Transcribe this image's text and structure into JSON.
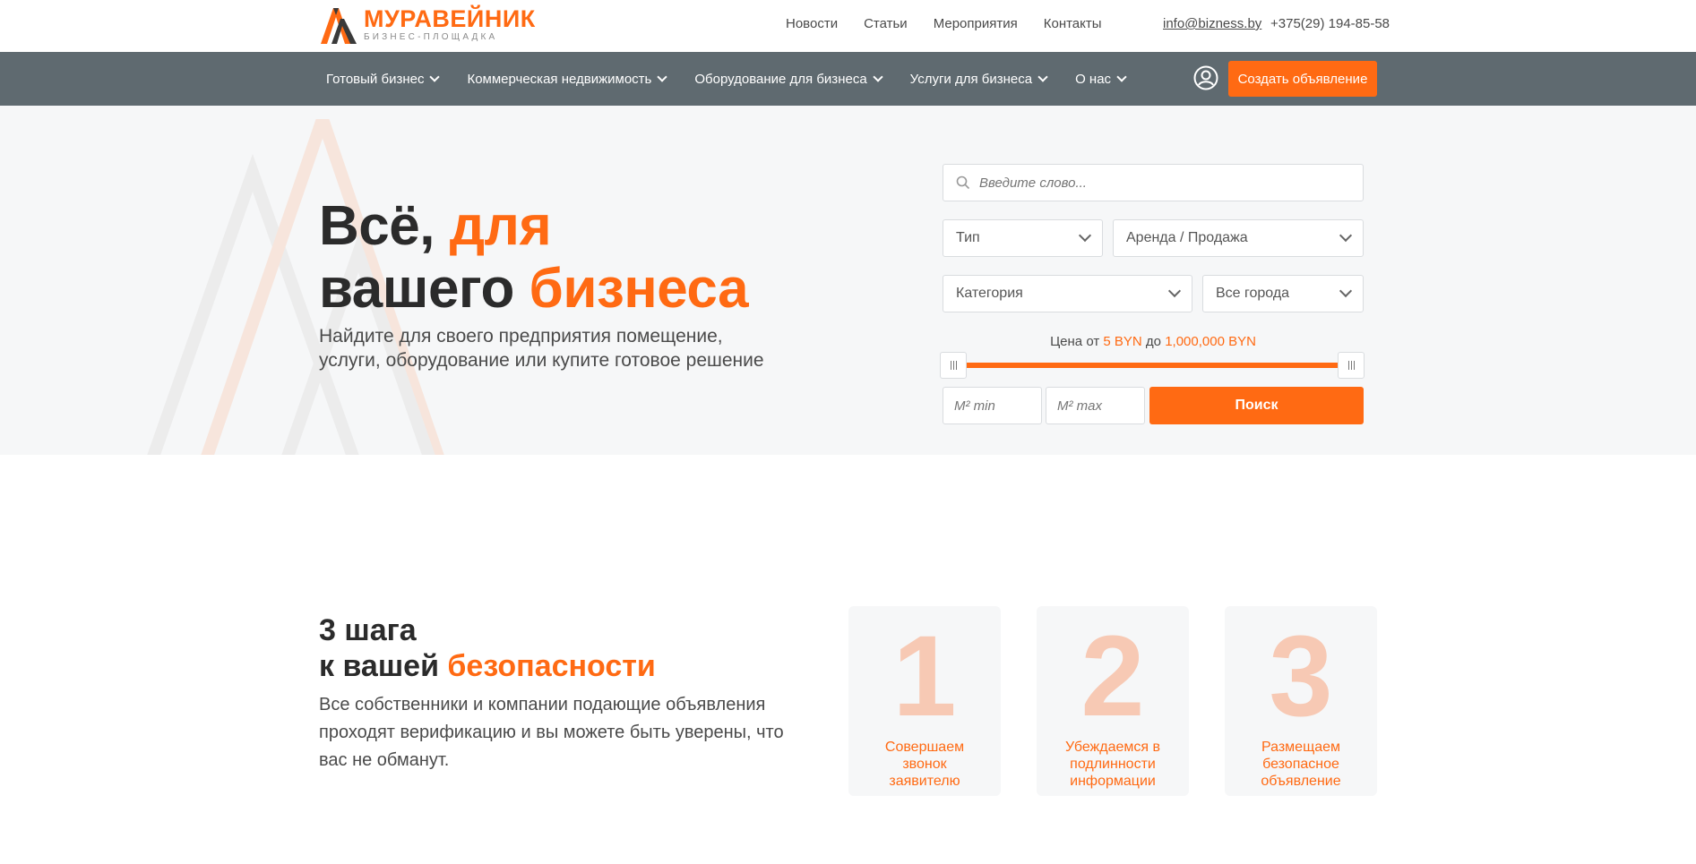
{
  "brand": {
    "name": "МУРАВЕЙНИК",
    "tagline": "БИЗНЕС-ПЛОЩАДКА",
    "accent_color": "#ff6a13",
    "nav_bg_color": "#5f6a70"
  },
  "top_nav": {
    "items": [
      "Новости",
      "Статьи",
      "Мероприятия",
      "Контакты"
    ],
    "email": "info@bizness.by",
    "phone": "+375(29) 194-85-58"
  },
  "main_nav": {
    "items": [
      {
        "label": "Готовый бизнес"
      },
      {
        "label": "Коммерческая недвижимость"
      },
      {
        "label": "Оборудование для бизнеса"
      },
      {
        "label": "Услуги для бизнеса"
      },
      {
        "label": "О нас"
      }
    ],
    "user_icon": "user-circle-icon",
    "create_button": "Создать объявление"
  },
  "hero": {
    "title_part1": "Всё, ",
    "title_part2": "для",
    "title_part3": "вашего ",
    "title_part4": "бизнеса",
    "subtitle": "Найдите для своего предприятия помещение, услуги, оборудование или купите готовое решение"
  },
  "search": {
    "placeholder": "Введите слово...",
    "type_select": "Тип",
    "deal_select": "Аренда / Продажа",
    "category_select": "Категория",
    "city_select": "Все города",
    "price_prefix": "Цена",
    "price_from_word": "от",
    "price_min": "5 BYN",
    "price_to_word": "до",
    "price_max": "1,000,000 BYN",
    "slider_min_fraction": 0.0,
    "slider_max_fraction": 1.0,
    "m2_min_placeholder": "М² min",
    "m2_max_placeholder": "М² max",
    "button": "Поиск"
  },
  "steps": {
    "title_line1": "3 шага",
    "title_line2_part1": "к вашей ",
    "title_line2_part2": "безопасности",
    "description": "Все собственники и компании подающие объявления проходят верификацию и вы можете быть уверены, что вас не обманут.",
    "cards": [
      {
        "number": "1",
        "text": "Совершаем звонок заявителю"
      },
      {
        "number": "2",
        "text": "Убеждаемся в подлинности информации"
      },
      {
        "number": "3",
        "text": "Размещаем безопасное объявление"
      }
    ]
  }
}
